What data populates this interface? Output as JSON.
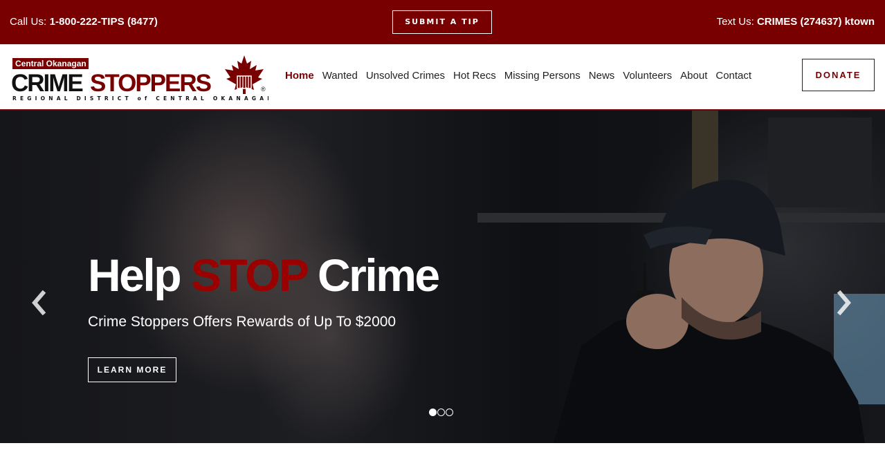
{
  "topbar": {
    "call_prefix": "Call Us: ",
    "call_number": "1-800-222-TIPS (8477)",
    "submit_tip": "SUBMIT A TIP",
    "text_prefix": "Text Us: ",
    "text_number": "CRIMES (274637) ktown"
  },
  "logo": {
    "top_text": "Central Okanagan",
    "main_left": "CRIME",
    "main_right": "STOPPERS",
    "sub_text": "REGIONAL DISTRICT of CENTRAL OKANAGAN",
    "registered": "®"
  },
  "nav": {
    "items": [
      "Home",
      "Wanted",
      "Unsolved Crimes",
      "Hot Recs",
      "Missing Persons",
      "News",
      "Volunteers",
      "About",
      "Contact"
    ],
    "active": "Home"
  },
  "donate": "DONATE",
  "hero": {
    "headline_1": "Help ",
    "headline_stop": "STOP",
    "headline_2": " Crime",
    "subline": "Crime Stoppers Offers Rewards of Up To $2000",
    "learn_more": "LEARN MORE",
    "slides": 3,
    "active_slide": 0
  },
  "colors": {
    "brand": "#790000",
    "stop_red": "#9b0000"
  },
  "icons": {
    "prev": "chevron-left-icon",
    "next": "chevron-right-icon",
    "logo_leaf": "maple-leaf-icon"
  }
}
